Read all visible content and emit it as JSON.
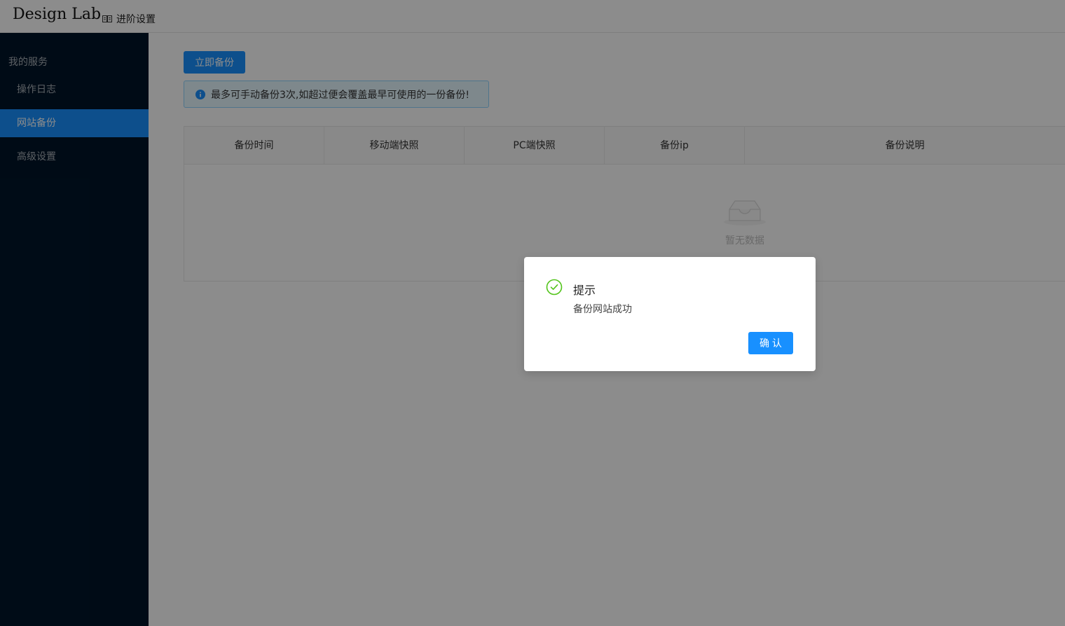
{
  "header": {
    "logo": "Design Lab",
    "breadcrumb": "进阶设置",
    "breadcrumb_icon": "book-icon"
  },
  "sidebar": {
    "group_title": "我的服务",
    "items": [
      {
        "label": "操作日志",
        "active": false
      },
      {
        "label": "网站备份",
        "active": true
      },
      {
        "label": "高级设置",
        "active": false
      }
    ]
  },
  "main": {
    "backup_button": "立即备份",
    "alert": {
      "icon": "info-icon",
      "text": "最多可手动备份3次,如超过便会覆盖最早可使用的一份备份!"
    },
    "table": {
      "columns": [
        "备份时间",
        "移动端快照",
        "PC端快照",
        "备份ip",
        "备份说明"
      ],
      "rows": [],
      "empty_text": "暂无数据",
      "empty_icon": "empty-inbox-icon"
    }
  },
  "modal": {
    "icon": "check-circle-icon",
    "title": "提示",
    "content": "备份网站成功",
    "confirm_label": "确 认"
  },
  "colors": {
    "primary": "#1890ff",
    "sidebar_bg": "#001529",
    "success": "#52c41a"
  }
}
